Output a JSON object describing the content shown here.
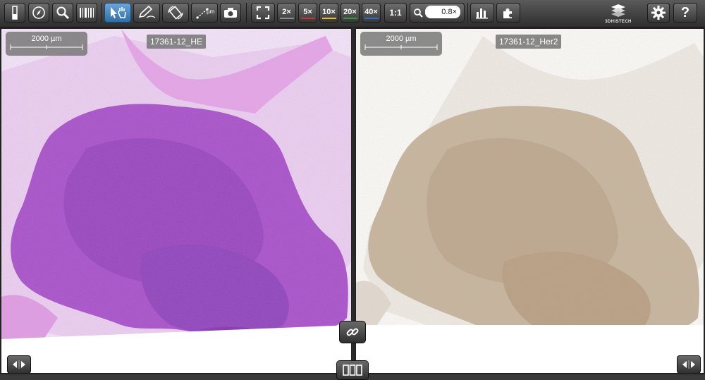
{
  "toolbar": {
    "zoom_levels": [
      {
        "label": "2×",
        "color": "#8a8a8a"
      },
      {
        "label": "5×",
        "color": "#d32f2f"
      },
      {
        "label": "10×",
        "color": "#e8c020"
      },
      {
        "label": "20×",
        "color": "#2e9e3c"
      },
      {
        "label": "40×",
        "color": "#2a6fd0"
      }
    ],
    "one_to_one": "1:1",
    "zoom_value": "0.8×",
    "brand": "3DHISTECH"
  },
  "viewers": [
    {
      "slide_name": "17361-12_HE",
      "scale_label": "2000 µm",
      "stain": "HE"
    },
    {
      "slide_name": "17361-12_Her2",
      "scale_label": "2000 µm",
      "stain": "Her2"
    }
  ],
  "colors": {
    "accent": "#3b82c4",
    "he_stain": "#9a3fbf",
    "her2_stain": "#b39a7c"
  }
}
